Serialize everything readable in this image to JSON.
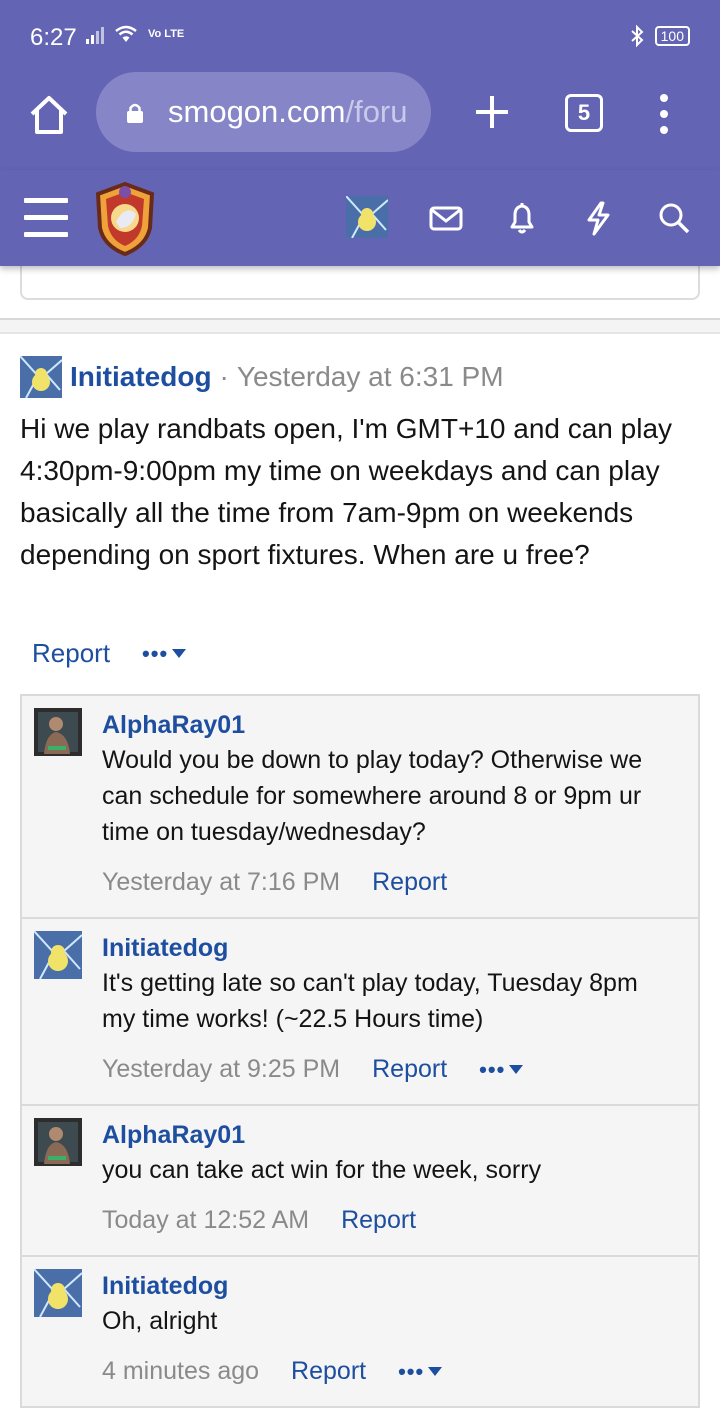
{
  "status_bar": {
    "time": "6:27",
    "network": "Vo LTE",
    "battery": "100"
  },
  "browser": {
    "url_host": "smogon.com",
    "url_path": "/foru",
    "tab_count": "5"
  },
  "post": {
    "author": "Initiatedog",
    "separator": "·",
    "time": "Yesterday at 6:31 PM",
    "body": "Hi we play randbats open, I'm GMT+10 and can play 4:30pm-9:00pm my time on weekdays and can play basically all the time from 7am-9pm on weekends depending on sport fixtures. When are u free?",
    "report_label": "Report",
    "more_label": "•••"
  },
  "comments": [
    {
      "author": "AlphaRay01",
      "text": "Would you be down to play today? Otherwise we can schedule for somewhere around 8 or 9pm ur time on tuesday/wednesday?",
      "time": "Yesterday at 7:16 PM",
      "report_label": "Report",
      "more_label": ""
    },
    {
      "author": "Initiatedog",
      "text": "It's getting late so can't play today, Tuesday 8pm my time works! (~22.5 Hours time)",
      "time": "Yesterday at 9:25 PM",
      "report_label": "Report",
      "more_label": "•••"
    },
    {
      "author": "AlphaRay01",
      "text": "you can take act win for the week, sorry",
      "time": "Today at 12:52 AM",
      "report_label": "Report",
      "more_label": ""
    },
    {
      "author": "Initiatedog",
      "text": "Oh, alright",
      "time": "4 minutes ago",
      "report_label": "Report",
      "more_label": "•••"
    }
  ],
  "icons": {
    "home": "home-icon",
    "lock": "lock-icon",
    "plus": "plus-icon",
    "menu": "more-vert-icon",
    "hamburger": "hamburger-icon",
    "mail": "mail-icon",
    "bell": "bell-icon",
    "bolt": "bolt-icon",
    "search": "search-icon"
  },
  "colors": {
    "header": "#6464b4",
    "link": "#1e4ea0",
    "meta": "#8a8a8a",
    "comment_bg": "#f5f5f5"
  }
}
